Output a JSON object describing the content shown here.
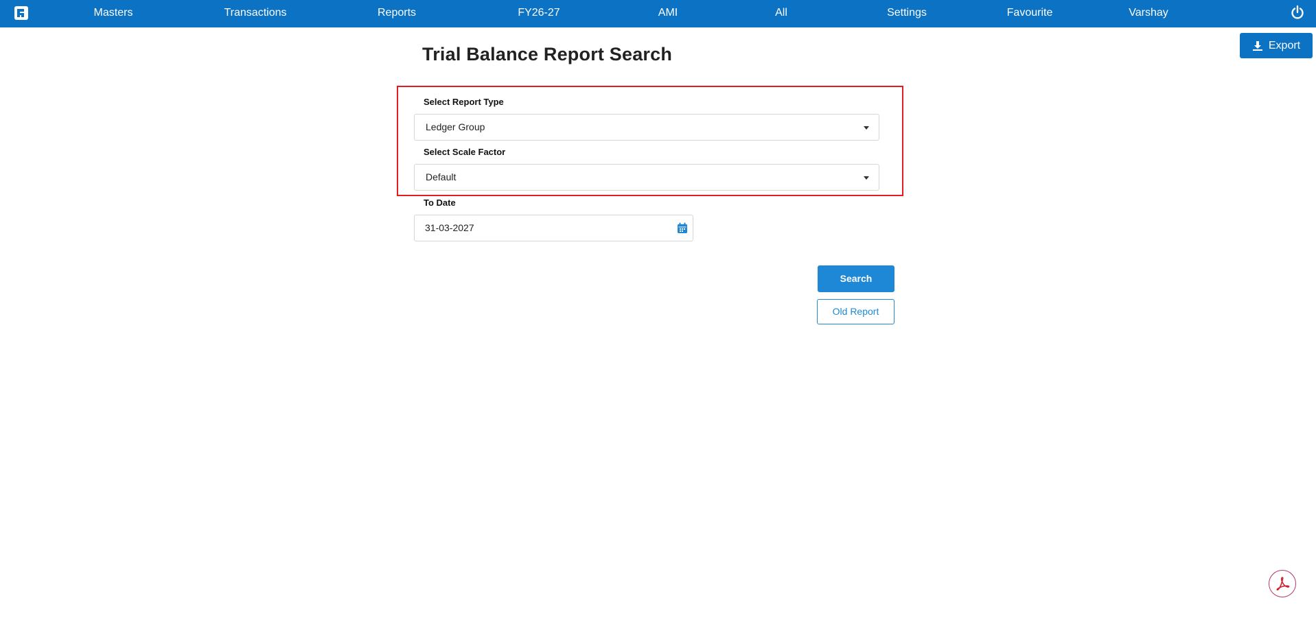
{
  "navbar": {
    "menu_items": [
      "Masters",
      "Transactions",
      "Reports",
      "FY26-27",
      "AMI",
      "All",
      "Settings",
      "Favourite",
      "Varshay"
    ]
  },
  "toolbar": {
    "export_label": "Export"
  },
  "page": {
    "title": "Trial Balance Report Search"
  },
  "form": {
    "report_type_label": "Select Report Type",
    "report_type_value": "Ledger Group",
    "scale_factor_label": "Select Scale Factor",
    "scale_factor_value": "Default",
    "to_date_label": "To Date",
    "to_date_value": "31-03-2027"
  },
  "actions": {
    "search_label": "Search",
    "old_report_label": "Old Report"
  },
  "icons": {
    "logo": "app-logo-icon",
    "power": "power-icon",
    "export": "download-icon",
    "calendar": "calendar-icon",
    "dropdown": "caret-down-icon",
    "pdf": "pdf-icon"
  },
  "colors": {
    "navbar": "#0b72c4",
    "primary_button": "#1e88d6",
    "highlight_border": "#e31b23",
    "pdf_icon": "#d01f2e"
  }
}
